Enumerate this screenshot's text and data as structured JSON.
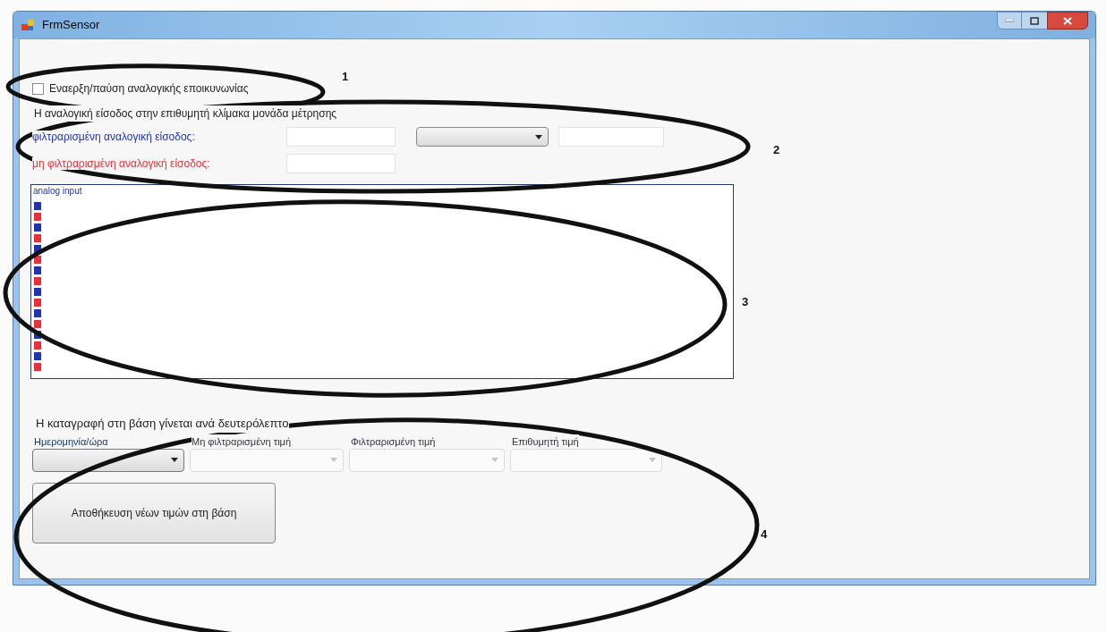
{
  "window": {
    "title": "FrmSensor"
  },
  "start_checkbox": {
    "label": "Εναερξη/παύση αναλογικής εποικυνωνίας",
    "checked": false
  },
  "scale_group": {
    "title": "Η αναλογική είσοδος στην επιθυμητή κλίμακα μονάδα μέτρησης",
    "filtered_label": "φιλτραρισμένη αναλογική είσοδος:",
    "unfiltered_label": "μη φιλτραρισμένη αναλογική είσοδος:"
  },
  "chart": {
    "title": "analog input",
    "series": [
      {
        "color": "#2233b0"
      },
      {
        "color": "#e8303a"
      }
    ]
  },
  "log_group": {
    "title": "Η καταγραφή στη βάση γίνεται ανά δευτερόλεπτο",
    "columns": [
      {
        "label": "Ημερομηνία/ώρα",
        "disabled": false
      },
      {
        "label": "Μη φιλτραρισμένη τιμή",
        "disabled": true
      },
      {
        "label": "Φιλτραρισμένη τιμή",
        "disabled": true
      },
      {
        "label": "Επιθυμητή τιμή",
        "disabled": true
      }
    ]
  },
  "save_button": "Αποθήκευση νέων τιμών στη βάση",
  "annotations": [
    {
      "label": "1"
    },
    {
      "label": "2"
    },
    {
      "label": "3"
    },
    {
      "label": "4"
    }
  ]
}
